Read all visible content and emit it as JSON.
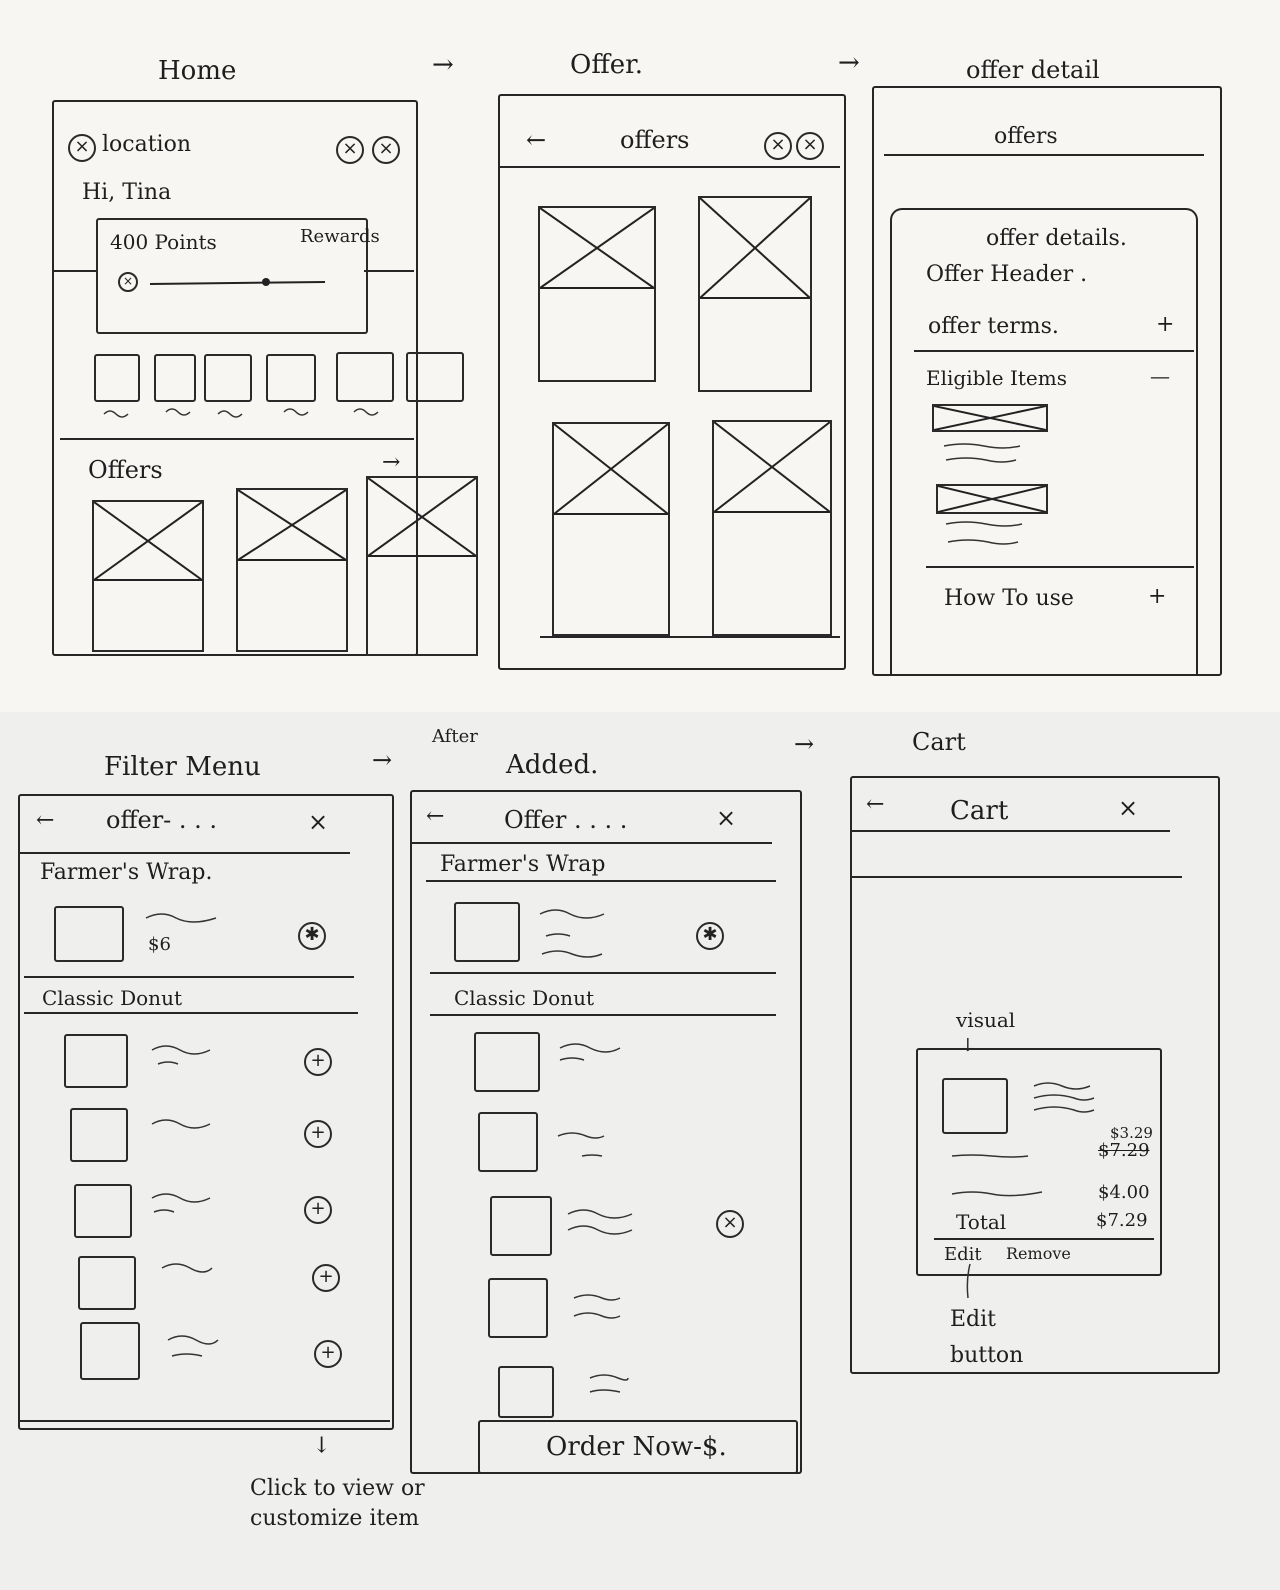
{
  "screens": {
    "home": {
      "caption": "Home",
      "location": "location",
      "greeting": "Hi, Tina",
      "points": "400 Points",
      "rewards": "Rewards",
      "offers_title": "Offers",
      "offers_arrow": "→"
    },
    "offer": {
      "caption": "Offer.",
      "title": "offers",
      "back": "←"
    },
    "offer_detail": {
      "caption": "offer detail",
      "title": "offers",
      "heading": "offer details.",
      "header_line": "Offer Header .",
      "terms": "offer terms.",
      "terms_toggle": "+",
      "eligible": "Eligible Items",
      "eligible_toggle": "—",
      "how_to_use": "How To use",
      "how_toggle": "+"
    },
    "filter_menu": {
      "caption": "Filter Menu",
      "title": "offer- . . .",
      "back": "←",
      "close": "×",
      "section1": "Farmer's Wrap.",
      "price": "$6",
      "section2": "Classic Donut",
      "note": "Click to view or customize item"
    },
    "after_added": {
      "caption_small": "After",
      "caption": "Added.",
      "title": "Offer . . . .",
      "back": "←",
      "close": "×",
      "section1": "Farmer's Wrap",
      "section2": "Classic Donut",
      "order_button": "Order Now-$."
    },
    "cart": {
      "caption": "Cart",
      "title": "Cart",
      "back": "←",
      "close": "×",
      "visual_label": "visual",
      "price_new": "$3.29",
      "price_old": "$7.29",
      "price_line2": "$4.00",
      "total_label": "Total",
      "total_value": "$7.29",
      "edit": "Edit",
      "remove": "Remove",
      "edit_note": "Edit button"
    }
  },
  "flow_arrow": "→"
}
